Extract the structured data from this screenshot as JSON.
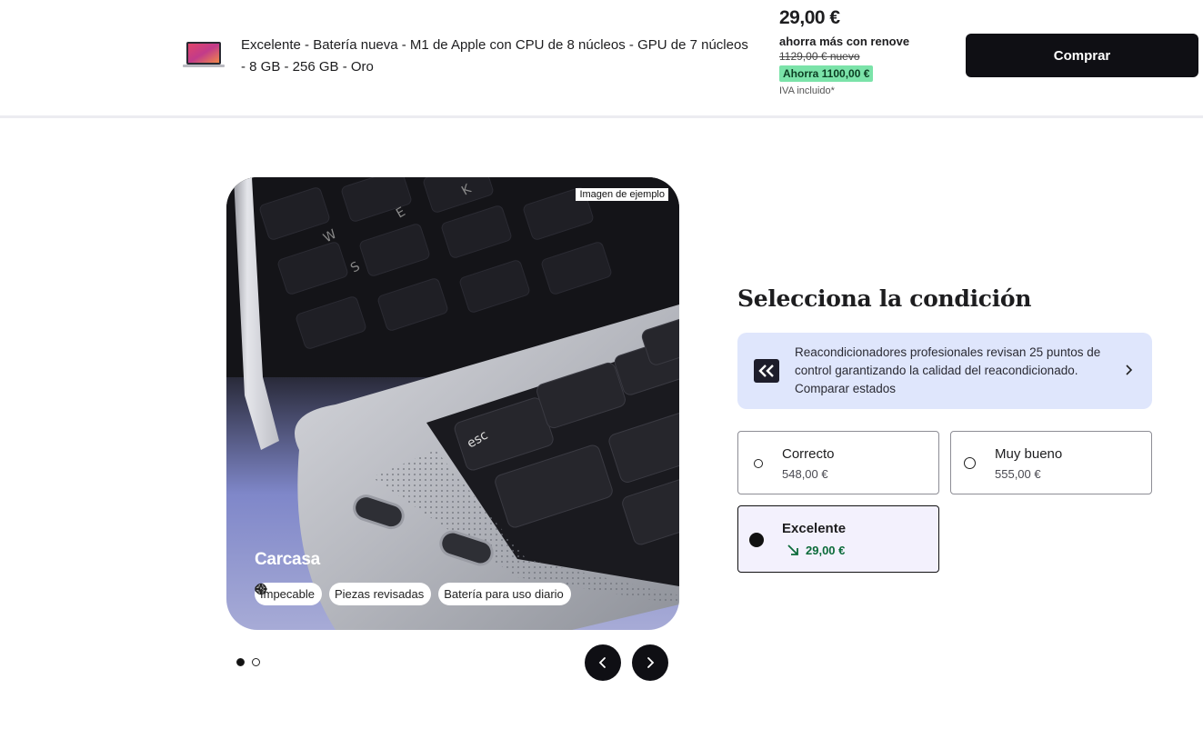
{
  "header": {
    "product_title": "Excelente - Batería nueva - M1 de Apple con CPU de 8 núcleos - GPU de 7 núcleos - 8 GB - 256 GB - Oro",
    "price": "29,00 €",
    "renove_text": "ahorra más con renove",
    "old_price": "1129,00 € nuevo",
    "savings": "Ahorra 1100,00 €",
    "vat_note": "IVA incluido*",
    "buy_label": "Comprar",
    "icons": {
      "thumbnail": "laptop-thumbnail"
    }
  },
  "gallery": {
    "sample_label": "Imagen de ejemplo",
    "caption": "Carcasa",
    "chips": [
      {
        "icon": "sparkle-icon",
        "label": "Impecable"
      },
      {
        "icon": "check-circle-icon",
        "label": "Piezas revisadas"
      },
      {
        "icon": "battery-icon",
        "label": "Batería para uso diario"
      }
    ],
    "keycaps": [
      "esc",
      "W",
      "S",
      "E",
      "K"
    ],
    "current_slide": 1,
    "total_slides": 2
  },
  "condition": {
    "title": "Selecciona la condición",
    "info_text": "Reacondicionadores profesionales revisan 25 puntos de control garantizando la calidad del reacondicionado. Comparar estados",
    "options": [
      {
        "name": "Correcto",
        "price": "548,00 €",
        "selected": false
      },
      {
        "name": "Muy bueno",
        "price": "555,00 €",
        "selected": false
      },
      {
        "name": "Excelente",
        "price": "29,00 €",
        "selected": true
      }
    ],
    "colors": {
      "selected_price": "#0c6b3a",
      "info_bg": "#dfe6fc",
      "savings_bg": "#7be3a9"
    }
  }
}
